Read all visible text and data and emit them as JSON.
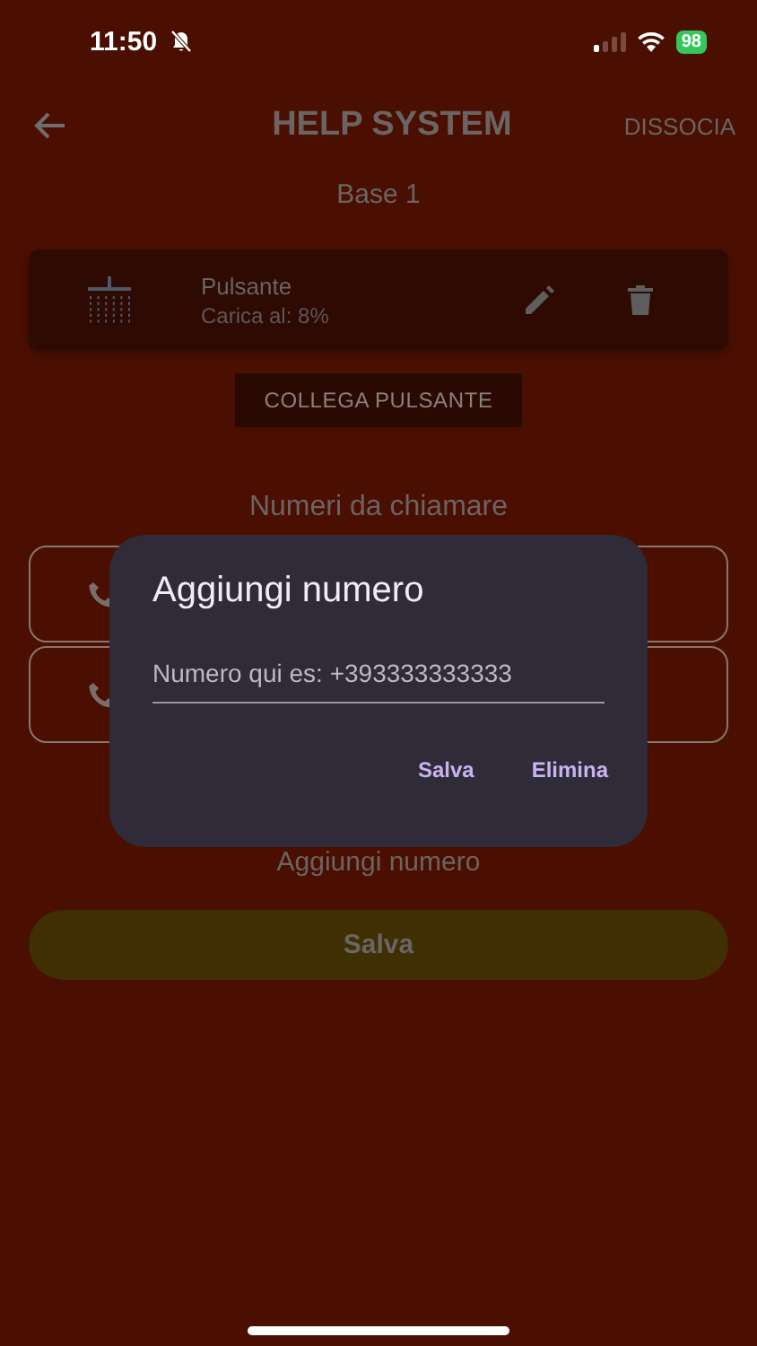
{
  "status_bar": {
    "time": "11:50",
    "battery": "98"
  },
  "app_bar": {
    "title": "HELP SYSTEM",
    "action": "DISSOCIA"
  },
  "base_name": "Base 1",
  "device": {
    "name": "Pulsante",
    "charge": "Carica al: 8%"
  },
  "link_button": "COLLEGA PULSANTE",
  "numbers_heading": "Numeri da chiamare",
  "number_fields": [
    {
      "kind": "phone"
    },
    {
      "kind": "phone"
    }
  ],
  "add_number": "Aggiungi numero",
  "save_button": "Salva",
  "dialog": {
    "title": "Aggiungi numero",
    "placeholder": "Numero qui es: +393333333333",
    "actions": [
      "Salva",
      "Elimina"
    ]
  }
}
